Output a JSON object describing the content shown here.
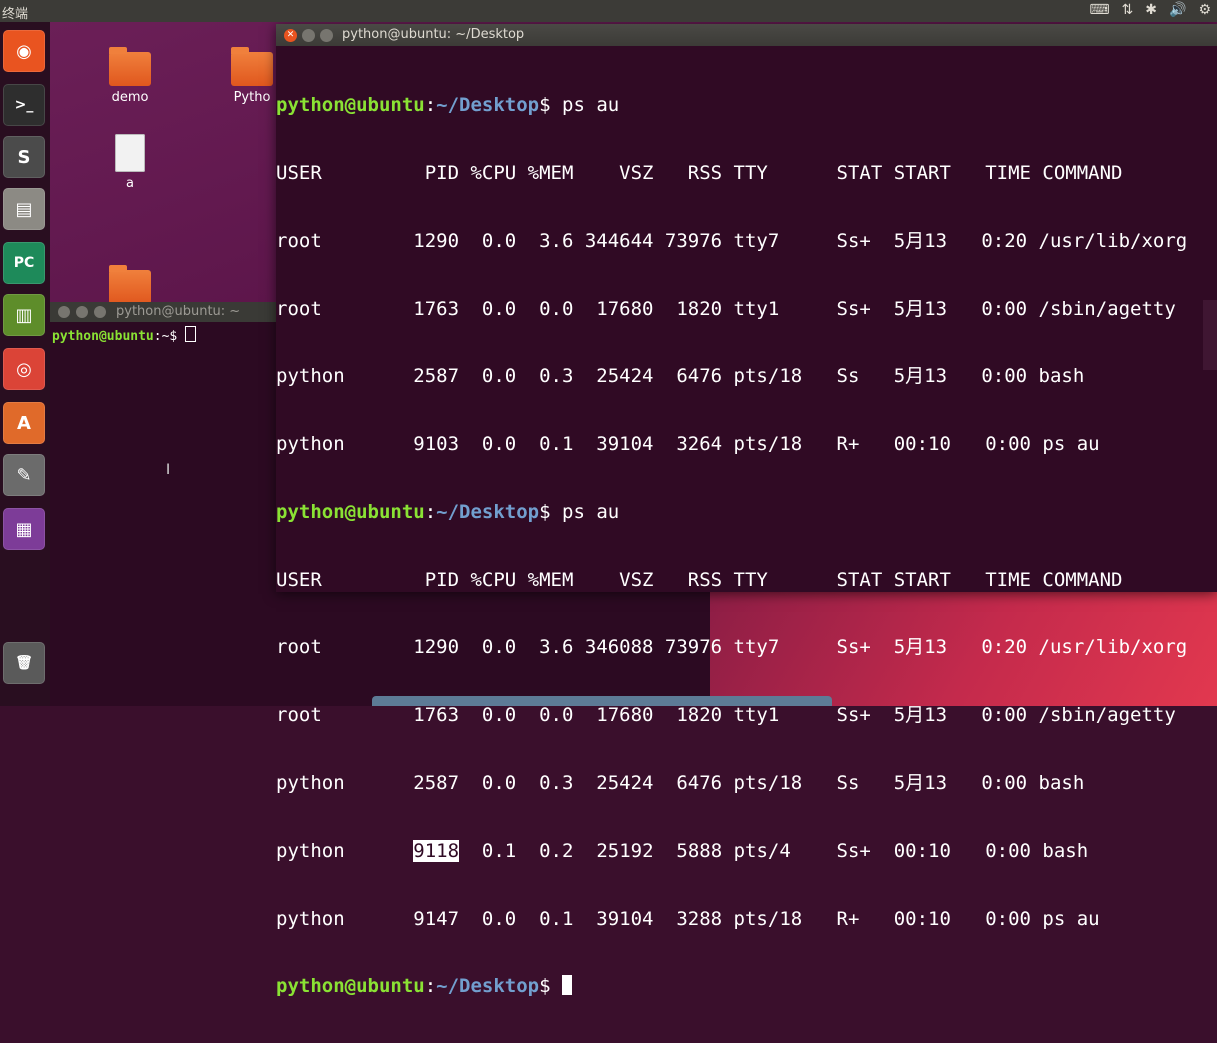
{
  "topbar": {
    "title": "终端",
    "indicators": [
      "⌨",
      "⇅",
      "✱",
      "🔊",
      "⚙"
    ]
  },
  "launcher": [
    {
      "name": "ubuntu-dash-icon",
      "glyph": "◉",
      "bg": "#e95420"
    },
    {
      "name": "terminal-icon",
      "glyph": ">_",
      "bg": "#2e2e2e"
    },
    {
      "name": "sublime-text-icon",
      "glyph": "S",
      "bg": "#4b4b4b"
    },
    {
      "name": "files-icon",
      "glyph": "▤",
      "bg": "#8c8a84"
    },
    {
      "name": "pycharm-icon",
      "glyph": "PC",
      "bg": "#1e8a5a"
    },
    {
      "name": "book-icon",
      "glyph": "▥",
      "bg": "#5e8d2a"
    },
    {
      "name": "chrome-icon",
      "glyph": "◎",
      "bg": "#db4437"
    },
    {
      "name": "software-center-icon",
      "glyph": "A",
      "bg": "#e06a2a"
    },
    {
      "name": "settings-icon",
      "glyph": "✎",
      "bg": "#6b6b6b"
    },
    {
      "name": "workspace-icon",
      "glyph": "▦",
      "bg": "#7d3c98"
    },
    {
      "name": "trash-icon",
      "glyph": "🗑",
      "bg": "#5a5a5a"
    }
  ],
  "desktop_icons": {
    "demo": "demo",
    "python_folder": "Pytho",
    "file_a": "a"
  },
  "small_terminal": {
    "title": "python@ubuntu: ~",
    "prompt_user": "python@ubuntu",
    "prompt_path": ":~$ "
  },
  "terminal": {
    "title": "python@ubuntu: ~/Desktop",
    "prompt": {
      "user": "python@ubuntu",
      "sep": ":",
      "path": "~/Desktop",
      "end": "$ "
    },
    "command1": "ps au",
    "command2": "ps au",
    "header": "USER         PID %CPU %MEM    VSZ   RSS TTY      STAT START   TIME COMMAND",
    "output1": [
      "root        1290  0.0  3.6 344644 73976 tty7     Ss+  5月13   0:20 /usr/lib/xorg",
      "root        1763  0.0  0.0  17680  1820 tty1     Ss+  5月13   0:00 /sbin/agetty",
      "python      2587  0.0  0.3  25424  6476 pts/18   Ss   5月13   0:00 bash",
      "python      9103  0.0  0.1  39104  3264 pts/18   R+   00:10   0:00 ps au"
    ],
    "output2": [
      "root        1290  0.0  3.6 346088 73976 tty7     Ss+  5月13   0:20 /usr/lib/xorg",
      "root        1763  0.0  0.0  17680  1820 tty1     Ss+  5月13   0:00 /sbin/agetty",
      "python      2587  0.0  0.3  25424  6476 pts/18   Ss   5月13   0:00 bash"
    ],
    "highlight_row": {
      "prefix": "python      ",
      "pid": "9118",
      "rest": "  0.1  0.2  25192  5888 pts/4    Ss+  00:10   0:00 bash"
    },
    "last_row": "python      9147  0.0  0.1  39104  3288 pts/18   R+   00:10   0:00 ps au"
  }
}
